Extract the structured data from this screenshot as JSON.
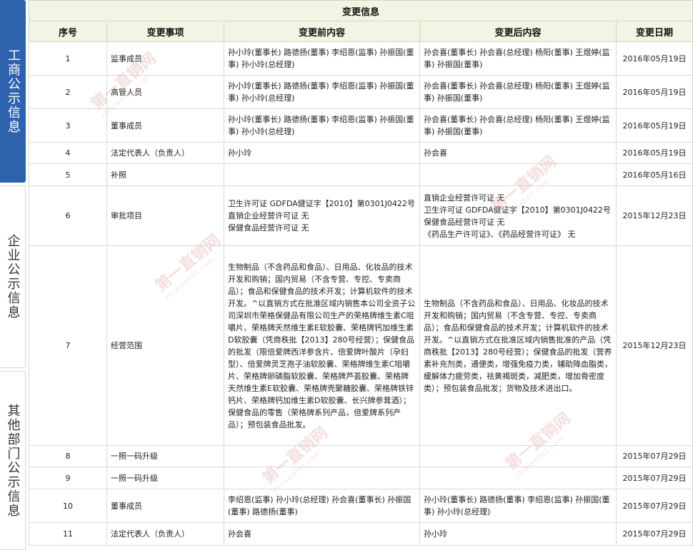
{
  "sidebar": {
    "tabs": [
      {
        "label": "工商公示信息",
        "active": true
      },
      {
        "label": "企业公示信息",
        "active": false
      },
      {
        "label": "其他部门公示信息",
        "active": false
      }
    ]
  },
  "table": {
    "title": "变更信息",
    "columns": [
      "序号",
      "变更事项",
      "变更前内容",
      "变更后内容",
      "变更日期"
    ],
    "rows": [
      {
        "no": "1",
        "item": "监事成员",
        "before": "孙小玲(董事长) 路德扬(董事) 李绍恩(监事) 孙振国(董事) 孙小玲(总经理)",
        "after": "孙会喜(董事长) 孙会喜(总经理) 杨阳(董事) 王煜婷(监事) 孙振国(董事)",
        "date": "2016年05月19日"
      },
      {
        "no": "2",
        "item": "高管人员",
        "before": "孙小玲(董事长) 路德扬(董事) 李绍恩(监事) 孙振国(董事) 孙小玲(总经理)",
        "after": "孙会喜(董事长) 孙会喜(总经理) 杨阳(董事) 王煜婷(监事) 孙振国(董事)",
        "date": "2016年05月19日"
      },
      {
        "no": "3",
        "item": "董事成员",
        "before": "孙小玲(董事长) 路德扬(董事) 李绍恩(监事) 孙振国(董事) 孙小玲(总经理)",
        "after": "孙会喜(董事长) 孙会喜(总经理) 杨阳(董事) 王煜婷(监事) 孙振国(董事)",
        "date": "2016年05月19日"
      },
      {
        "no": "4",
        "item": "法定代表人（负责人）",
        "before": "孙小玲",
        "after": "孙会喜",
        "date": "2016年05月19日"
      },
      {
        "no": "5",
        "item": "补照",
        "before": "",
        "after": "",
        "date": "2016年05月16日"
      },
      {
        "no": "6",
        "item": "审批项目",
        "before": "卫生许可证 GDFDA健证字【2010】第0301J0422号\n直销企业经营许可证 无\n保健食品经营许可证 无",
        "after": "直销企业经营许可证 无\n卫生许可证 GDFDA健证字【2010】第0301J0422号\n保健食品经营许可证 无\n《药品生产许可证》、《药品经营许可证》 无",
        "date": "2015年12月23日"
      },
      {
        "no": "7",
        "item": "经营范围",
        "before": "生物制品（不含药品和食品）、日用品、化妆品的技术开发和购销；国内贸易（不含专营、专控、专卖商品）；食品和保健食品的技术开发；计算机软件的技术开发。^以直销方式在批准区域内销售本公司全资子公司深圳市荣格保健品有限公司生产的荣格牌维生素C咀嚼片、荣格牌天然维生素E软胶囊、荣格牌钙加维生素D软胶囊（凭商秩批【2013】280号经营）；保健食品的批发（限倍爱牌西洋参含片、倍爱牌叶酸片（孕妇型）、倍爱牌灵芝孢子油软胶囊、荣格牌维生素C咀嚼片、荣格牌卵磷脂软胶囊、荣格牌芦荟胶囊、荣格牌天然维生素E软胶囊、荣格牌壳聚糖胶囊、荣格牌铁锌钙片、荣格牌钙加维生素D软胶囊、长兴牌参茸酒）；保健食品的零售（荣格牌系列产品，倍爱牌系列产品）；预包装食品批发。",
        "after": "生物制品（不含药品和食品）、日用品、化妆品的技术开发和购销；国内贸易（不含专营、专控、专卖商品）；食品和保健食品的技术开发；计算机软件的技术开发。^以直销方式在批准区域内销售批准的产品（凭商秩批【2013】280号经营）；保健食品的批发（营养素补充剂类，通便类，增强免疫力类，辅助降血脂类，缓解体力疲劳类，祛黄褐斑类，减肥类，增加骨密度类）；预包装食品批发；货物及技术进出口。",
        "date": "2015年12月23日"
      },
      {
        "no": "8",
        "item": "一照一码升级",
        "before": "",
        "after": "",
        "date": "2015年07月29日"
      },
      {
        "no": "9",
        "item": "一照一码升级",
        "before": "",
        "after": "",
        "date": "2015年07月29日"
      },
      {
        "no": "10",
        "item": "董事成员",
        "before": "李绍恩(监事) 孙小玲(总经理) 孙会喜(董事长) 孙振国(董事) 路德扬(董事)",
        "after": "孙小玲(董事长) 路德扬(董事) 李绍恩(监事) 孙振国(董事) 孙小玲(总经理)",
        "date": "2015年07月29日"
      },
      {
        "no": "11",
        "item": "法定代表人（负责人）",
        "before": "孙会喜",
        "after": "孙小玲",
        "date": "2015年07月29日"
      }
    ]
  },
  "watermark": {
    "text": "第一直销网",
    "sub": "zhixiao001.com"
  },
  "colors": {
    "accent": "#2f62ad",
    "header_bg": "#f1f6e4",
    "border": "#d9d9d9"
  }
}
